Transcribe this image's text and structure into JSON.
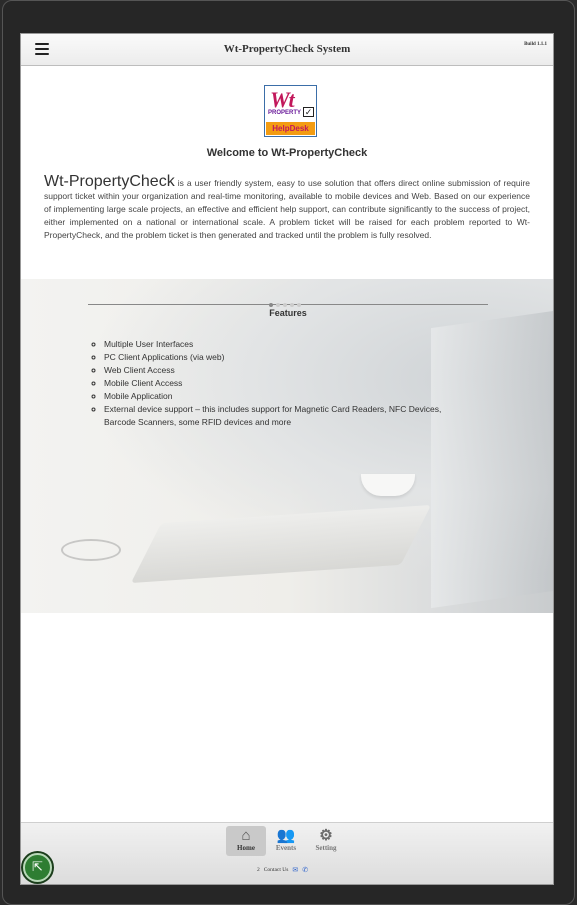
{
  "header": {
    "title": "Wt-PropertyCheck System",
    "build": "Build 1.1.1"
  },
  "logo": {
    "wt": "Wt",
    "property": "PROPERTY",
    "helpdesk": "HelpDesk"
  },
  "main": {
    "welcome": "Welcome to Wt-PropertyCheck",
    "brand": "Wt-PropertyCheck",
    "intro": " is a user friendly system, easy to use solution that offers direct online submission of require support ticket within your organization and real-time monitoring, available to mobile devices and Web. Based on our experience of implementing large scale projects, an effective and efficient help support, can contribute significantly to the success of project, either implemented on a national or international scale. A problem ticket will be raised for each problem reported to Wt-PropertyCheck, and the problem ticket is then generated and tracked until the problem is fully resolved."
  },
  "features": {
    "title": "Features",
    "items": [
      "Multiple User Interfaces",
      "PC Client Applications (via web)",
      "Web Client Access",
      "Mobile Client Access",
      "Mobile Application",
      "External device support – this includes support for Magnetic Card Readers, NFC Devices, Barcode Scanners, some RFID devices and more"
    ],
    "slide_count": 5,
    "active_slide": 1
  },
  "nav": {
    "home": "Home",
    "events": "Events",
    "setting": "Setting",
    "icons": [
      "home-icon",
      "users-icon",
      "gear-icon"
    ]
  },
  "footer": {
    "count": "2",
    "contact_label": "Contact Us"
  },
  "colors": {
    "fab": "#2e7d32",
    "accent": "#3366cc"
  }
}
